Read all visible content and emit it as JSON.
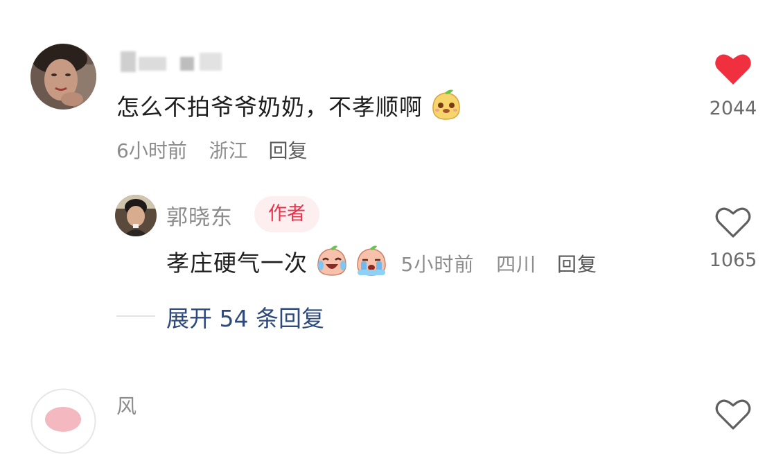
{
  "comment": {
    "username": "",
    "text": "怎么不拍爷爷奶奶，不孝顺啊",
    "emoji_icon": "smiling-pear-emoji-icon",
    "time": "6小时前",
    "location": "浙江",
    "reply_label": "回复",
    "like_count": "2044",
    "liked": true
  },
  "reply": {
    "username": "郭晓东",
    "badge": "作者",
    "text": "孝庄硬气一次",
    "emoji_icons": [
      "laughing-crying-emoji-icon",
      "crying-emoji-icon"
    ],
    "time": "5小时前",
    "location": "四川",
    "reply_label": "回复",
    "like_count": "1065",
    "liked": false
  },
  "expand_label": "展开 54 条回复",
  "next_comment": {
    "username": "风"
  },
  "colors": {
    "like_active": "#f0303f",
    "badge_bg": "#fdeef0",
    "badge_text": "#e8334b",
    "expand_text": "#2e4a7c"
  }
}
